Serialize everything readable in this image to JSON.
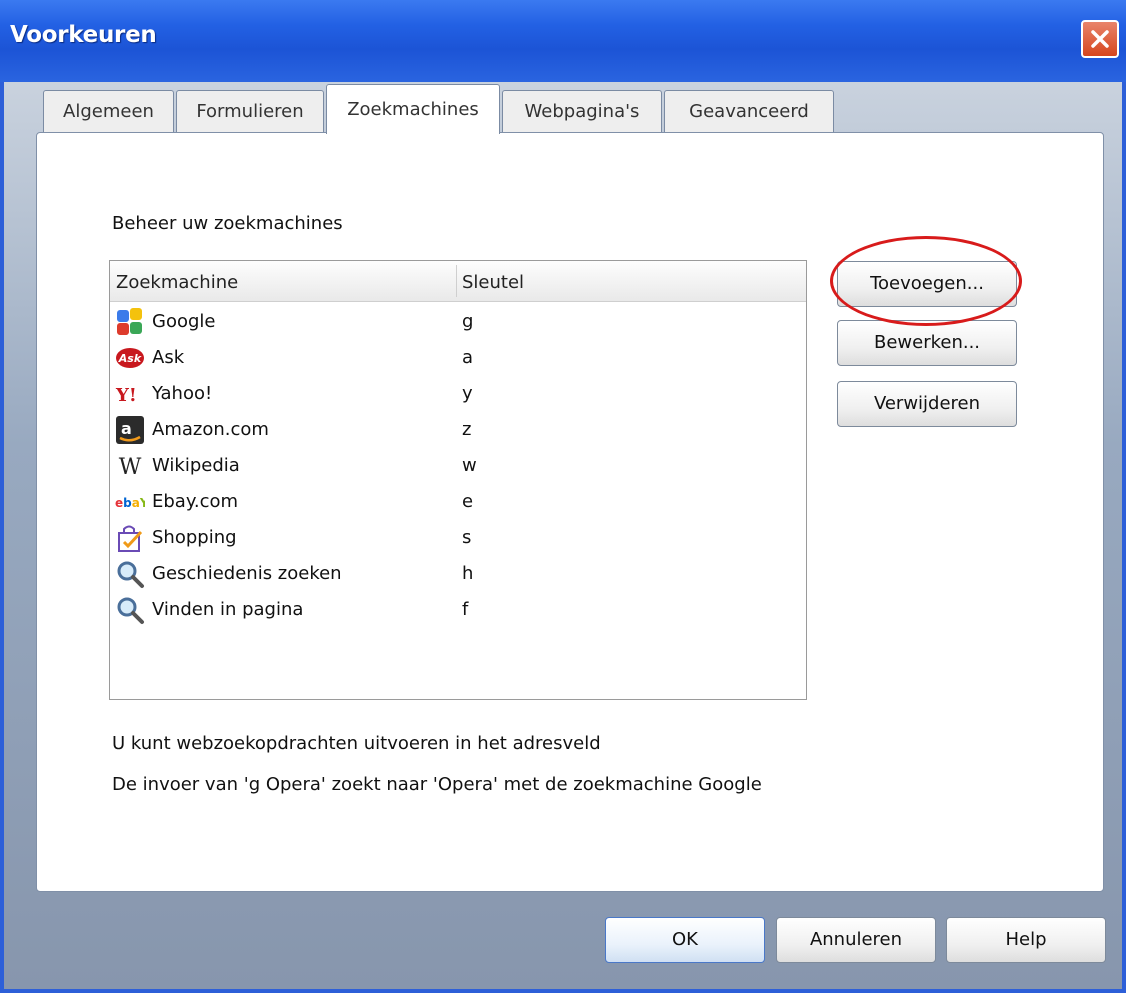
{
  "window": {
    "title": "Voorkeuren",
    "close_icon": "close-icon"
  },
  "tabs": [
    {
      "label": "Algemeen"
    },
    {
      "label": "Formulieren"
    },
    {
      "label": "Zoekmachines"
    },
    {
      "label": "Webpagina's"
    },
    {
      "label": "Geavanceerd"
    }
  ],
  "active_tab": "Zoekmachines",
  "panel": {
    "heading": "Beheer uw zoekmachines",
    "columns": {
      "engine": "Zoekmachine",
      "key": "Sleutel"
    },
    "engines": [
      {
        "name": "Google",
        "key": "g",
        "icon": "google-icon"
      },
      {
        "name": "Ask",
        "key": "a",
        "icon": "ask-icon"
      },
      {
        "name": "Yahoo!",
        "key": "y",
        "icon": "yahoo-icon"
      },
      {
        "name": "Amazon.com",
        "key": "z",
        "icon": "amazon-icon"
      },
      {
        "name": "Wikipedia",
        "key": "w",
        "icon": "wikipedia-icon"
      },
      {
        "name": "Ebay.com",
        "key": "e",
        "icon": "ebay-icon"
      },
      {
        "name": "Shopping",
        "key": "s",
        "icon": "shopping-bag-icon"
      },
      {
        "name": "Geschiedenis zoeken",
        "key": "h",
        "icon": "magnifier-icon"
      },
      {
        "name": "Vinden in pagina",
        "key": "f",
        "icon": "magnifier-icon"
      }
    ],
    "buttons": {
      "add": "Toevoegen...",
      "edit": "Bewerken...",
      "remove": "Verwijderen"
    },
    "info_line1": "U kunt webzoekopdrachten uitvoeren in het adresveld",
    "info_line2": "De invoer van 'g Opera' zoekt naar 'Opera' met de zoekmachine Google"
  },
  "footer": {
    "ok": "OK",
    "cancel": "Annuleren",
    "help": "Help"
  },
  "colors": {
    "titlebar": "#2361e4",
    "highlight": "#d81b1b",
    "accent": "#2d5fd8"
  }
}
